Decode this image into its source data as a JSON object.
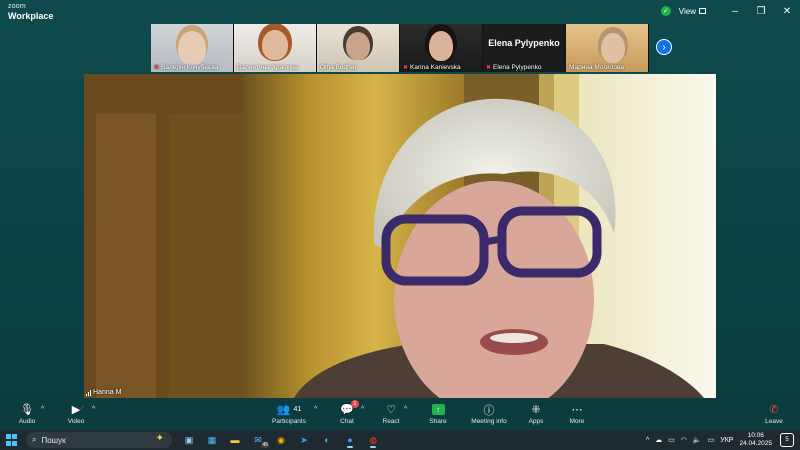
{
  "app": {
    "logo_top": "zoom",
    "logo_bottom": "Workplace",
    "view_label": "View"
  },
  "thumbnails": [
    {
      "name": "Валерія Кочубеєва",
      "muted": true
    },
    {
      "name": "Валентина Храпкіна",
      "muted": false
    },
    {
      "name": "Olha Bodnar",
      "muted": false
    },
    {
      "name": "Karina Kanievska",
      "muted": true
    },
    {
      "name": "Elena Pylypenko",
      "muted": true,
      "big_name": "Elena Pylypenko"
    },
    {
      "name": "Марина Могилова",
      "muted": false
    }
  ],
  "main_video": {
    "speaker_name": "Hanna M"
  },
  "toolbar": {
    "audio": "Audio",
    "video": "Video",
    "participants": "Participants",
    "participants_count": "41",
    "chat": "Chat",
    "chat_badge": "1",
    "react": "React",
    "share": "Share",
    "meeting_info": "Meeting info",
    "apps": "Apps",
    "more": "More",
    "leave": "Leave"
  },
  "taskbar": {
    "search_placeholder": "Пошук",
    "mail_badge": "45",
    "language": "УКР",
    "time": "10:06",
    "date": "24.04.2025",
    "notifications": "5"
  },
  "colors": {
    "app_bg": "#0d3f42",
    "accent_blue": "#0e72ed",
    "share_green": "#22b14c",
    "mute_red": "#e5484d"
  }
}
